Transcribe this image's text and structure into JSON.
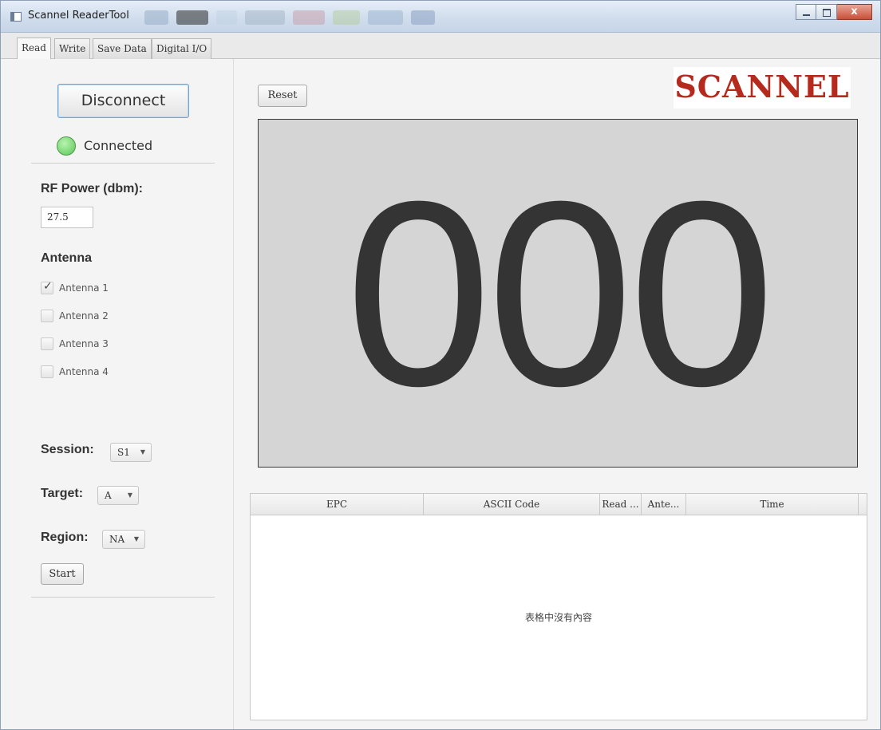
{
  "window": {
    "title": "Scannel ReaderTool"
  },
  "tabs": [
    {
      "label": "Read"
    },
    {
      "label": "Write"
    },
    {
      "label": "Save Data"
    },
    {
      "label": "Digital I/O"
    }
  ],
  "connection": {
    "button_label": "Disconnect",
    "status": "Connected",
    "status_color": "#7fd97a"
  },
  "rf_power": {
    "label": "RF Power (dbm):",
    "value": "27.5"
  },
  "antenna": {
    "label": "Antenna",
    "items": [
      {
        "label": "Antenna 1",
        "checked": true
      },
      {
        "label": "Antenna 2",
        "checked": false
      },
      {
        "label": "Antenna 3",
        "checked": false
      },
      {
        "label": "Antenna 4",
        "checked": false
      }
    ]
  },
  "session": {
    "label": "Session:",
    "value": "S1"
  },
  "target": {
    "label": "Target:",
    "value": "A"
  },
  "region": {
    "label": "Region:",
    "value": "NA"
  },
  "start_label": "Start",
  "reset_label": "Reset",
  "logo": {
    "text": "SCANNEL",
    "color": "#b52a1d"
  },
  "counter": "000",
  "table": {
    "columns": [
      "EPC",
      "ASCII Code",
      "Read ...",
      "Ante...",
      "Time"
    ],
    "empty_message": "表格中沒有內容"
  }
}
